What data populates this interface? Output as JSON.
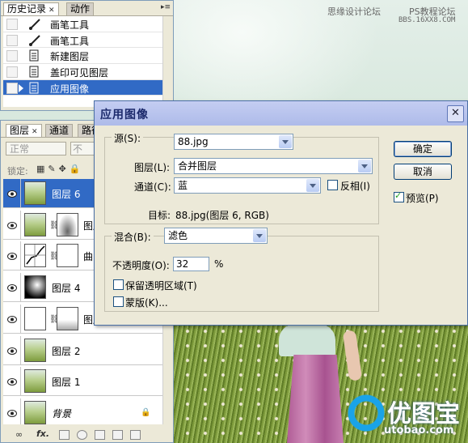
{
  "watermarks": {
    "site_cn": "思缘设计论坛",
    "ps_forum": "PS教程论坛",
    "bbs_url": "BBS.16XX8.COM"
  },
  "logo": {
    "text": "优图宝",
    "url": "utobao.com"
  },
  "history_panel": {
    "tabs": [
      {
        "label": "历史记录",
        "active": true,
        "closable": true
      },
      {
        "label": "动作",
        "active": false
      }
    ],
    "items": [
      {
        "label": "画笔工具",
        "icon": "brush-icon",
        "selected": false
      },
      {
        "label": "画笔工具",
        "icon": "brush-icon",
        "selected": false
      },
      {
        "label": "新建图层",
        "icon": "document-icon",
        "selected": false
      },
      {
        "label": "盖印可见图层",
        "icon": "document-icon",
        "selected": false
      },
      {
        "label": "应用图像",
        "icon": "document-icon",
        "selected": true
      }
    ]
  },
  "layers_panel": {
    "tabs": [
      {
        "label": "图层",
        "active": true,
        "closable": true
      },
      {
        "label": "通道",
        "active": false
      },
      {
        "label": "路径",
        "active": false
      }
    ],
    "blend_mode": "正常",
    "opacity_label": "不",
    "lock_label": "锁定:",
    "layers": [
      {
        "name": "图层 6",
        "selected": true,
        "has_mask": false,
        "thumb": "photo"
      },
      {
        "name": "图层",
        "selected": false,
        "has_mask": true,
        "thumb": "photo"
      },
      {
        "name": "曲",
        "selected": false,
        "has_mask": true,
        "thumb": "curves"
      },
      {
        "name": "图层 4",
        "selected": false,
        "has_mask": false,
        "thumb": "radial-black"
      },
      {
        "name": "图层",
        "selected": false,
        "has_mask": true,
        "thumb": "white"
      },
      {
        "name": "图层 2",
        "selected": false,
        "has_mask": false,
        "thumb": "photo"
      },
      {
        "name": "图层 1",
        "selected": false,
        "has_mask": false,
        "thumb": "photo"
      },
      {
        "name": "背景",
        "selected": false,
        "has_mask": false,
        "thumb": "photo",
        "locked": true,
        "italic": true
      }
    ],
    "footer_fx": "fx."
  },
  "dialog": {
    "title": "应用图像",
    "source": {
      "label": "源(S):",
      "value": "88.jpg"
    },
    "layer": {
      "label": "图层(L):",
      "value": "合并图层"
    },
    "channel": {
      "label": "通道(C):",
      "value": "蓝"
    },
    "invert": {
      "label": "反相(I)",
      "checked": false
    },
    "target": {
      "label": "目标:",
      "value": "88.jpg(图层 6, RGB)"
    },
    "blending": {
      "label": "混合(B):",
      "value": "滤色"
    },
    "opacity": {
      "label": "不透明度(O):",
      "value": "32",
      "unit": "%"
    },
    "preserve_transparency": {
      "label": "保留透明区域(T)",
      "checked": false
    },
    "mask": {
      "label": "蒙版(K)...",
      "checked": false
    },
    "ok_label": "确定",
    "cancel_label": "取消",
    "preview": {
      "label": "预览(P)",
      "checked": true
    },
    "colors": {
      "title_bar": "#aebbe9",
      "accent": "#316ac5"
    }
  }
}
